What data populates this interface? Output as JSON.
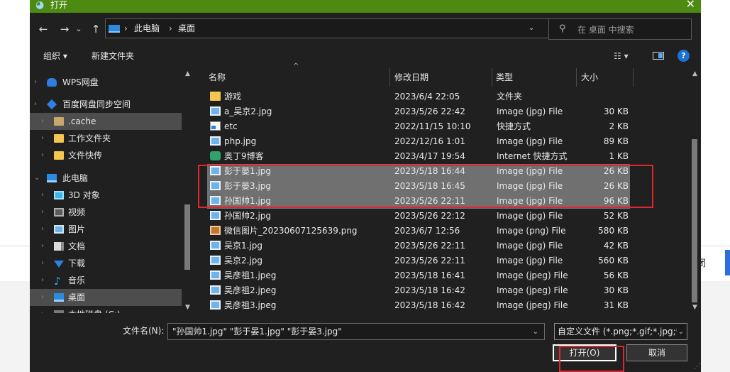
{
  "background": {
    "close_partial": "闭"
  },
  "dialog": {
    "title": "打开",
    "close_glyph": "✕"
  },
  "nav": {
    "back": "←",
    "forward": "→",
    "recent": "⌄",
    "up": "↑"
  },
  "address": {
    "crumbs": [
      "此电脑",
      "桌面"
    ],
    "separator": "›",
    "dropdown_glyph": "⌄",
    "refresh_glyph": "↻"
  },
  "search": {
    "placeholder": "在 桌面 中搜索",
    "icon": "⚲"
  },
  "toolbar": {
    "organize": "组织 ▾",
    "new_folder": "新建文件夹",
    "view_glyph": "☷ ▾",
    "help_glyph": "?"
  },
  "sidebar": {
    "items": [
      {
        "label": "WPS网盘",
        "icon": "cloud-icon"
      },
      {
        "label": "百度网盘同步空间",
        "icon": "baidu-netdisk-icon"
      },
      {
        "label": ".cache",
        "icon": "folder-icon"
      },
      {
        "label": "工作文件夹",
        "icon": "folder-icon"
      },
      {
        "label": "文件快传",
        "icon": "folder-icon"
      },
      {
        "label": "此电脑",
        "icon": "computer-icon"
      },
      {
        "label": "3D 对象",
        "icon": "3d-objects-icon"
      },
      {
        "label": "视频",
        "icon": "video-icon"
      },
      {
        "label": "图片",
        "icon": "pictures-icon"
      },
      {
        "label": "文档",
        "icon": "documents-icon"
      },
      {
        "label": "下载",
        "icon": "download-icon"
      },
      {
        "label": "音乐",
        "icon": "music-icon"
      },
      {
        "label": "桌面",
        "icon": "desktop-icon"
      },
      {
        "label": "本地磁盘 (C:)",
        "icon": "disk-icon"
      }
    ]
  },
  "columns": {
    "name": "名称",
    "date": "修改日期",
    "type": "类型",
    "size": "大小",
    "sort_glyph": "^"
  },
  "files": [
    {
      "name": "游戏",
      "date": "2023/6/4 22:05",
      "type": "文件夹",
      "size": "",
      "icon": "folder-icon",
      "selected": false
    },
    {
      "name": "a_吴京2.jpg",
      "date": "2023/5/26 22:42",
      "type": "Image (jpg) File",
      "size": "30 KB",
      "icon": "image-file-icon",
      "selected": false
    },
    {
      "name": "etc",
      "date": "2022/11/15 10:10",
      "type": "快捷方式",
      "size": "2 KB",
      "icon": "shortcut-icon",
      "selected": false
    },
    {
      "name": "php.jpg",
      "date": "2022/12/16 1:01",
      "type": "Image (jpg) File",
      "size": "89 KB",
      "icon": "image-file-icon",
      "selected": false
    },
    {
      "name": "奥丁9博客",
      "date": "2023/4/17 19:54",
      "type": "Internet 快捷方式",
      "size": "1 KB",
      "icon": "internet-shortcut-icon",
      "selected": false
    },
    {
      "name": "彭于晏1.jpg",
      "date": "2023/5/18 16:44",
      "type": "Image (jpg) File",
      "size": "26 KB",
      "icon": "image-file-icon",
      "selected": true
    },
    {
      "name": "彭于晏3.jpg",
      "date": "2023/5/18 16:45",
      "type": "Image (jpg) File",
      "size": "26 KB",
      "icon": "image-file-icon",
      "selected": true
    },
    {
      "name": "孙国帅1.jpg",
      "date": "2023/5/26 22:11",
      "type": "Image (jpg) File",
      "size": "96 KB",
      "icon": "image-file-icon",
      "selected": true
    },
    {
      "name": "孙国帅2.jpg",
      "date": "2023/5/26 22:12",
      "type": "Image (jpg) File",
      "size": "52 KB",
      "icon": "image-file-icon",
      "selected": false
    },
    {
      "name": "微信图片_20230607125639.png",
      "date": "2023/6/7 12:56",
      "type": "Image (png) File",
      "size": "580 KB",
      "icon": "png-file-icon",
      "selected": false
    },
    {
      "name": "吴京1.jpg",
      "date": "2023/5/26 22:11",
      "type": "Image (jpg) File",
      "size": "42 KB",
      "icon": "image-file-icon",
      "selected": false
    },
    {
      "name": "吴京2.jpg",
      "date": "2023/5/26 22:11",
      "type": "Image (jpg) File",
      "size": "560 KB",
      "icon": "image-file-icon",
      "selected": false
    },
    {
      "name": "吴彦祖1.jpeg",
      "date": "2023/5/18 16:41",
      "type": "Image (jpeg) File",
      "size": "56 KB",
      "icon": "image-file-icon",
      "selected": false
    },
    {
      "name": "吴彦祖2.jpeg",
      "date": "2023/5/18 16:42",
      "type": "Image (jpeg) File",
      "size": "30 KB",
      "icon": "image-file-icon",
      "selected": false
    },
    {
      "name": "吴彦祖3.jpeg",
      "date": "2023/5/18 16:42",
      "type": "Image (jpeg) File",
      "size": "31 KB",
      "icon": "image-file-icon",
      "selected": false
    }
  ],
  "footer": {
    "filename_label": "文件名(N):",
    "filename_value": "\"孙国帅1.jpg\" \"彭于晏1.jpg\" \"彭于晏3.jpg\"",
    "filter_value": "自定义文件 (*.png;*.gif;*.jpg;*",
    "dropdown_glyph": "⌄",
    "open_button": "打开(O)",
    "cancel_button": "取消"
  },
  "colors": {
    "titlebar": "#4c8a12",
    "dialog_bg": "#202020",
    "selection": "#707070",
    "annotation_red": "#e3262d"
  }
}
